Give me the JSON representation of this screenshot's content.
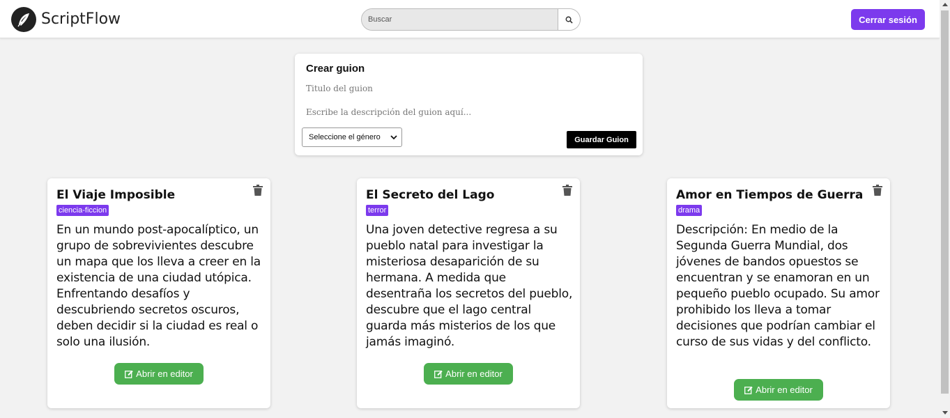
{
  "header": {
    "brand": "ScriptFlow",
    "logo_icon": "feather-icon",
    "search_placeholder": "Buscar",
    "search_icon": "search-icon",
    "logout_label": "Cerrar sesión"
  },
  "create": {
    "title": "Crear guion",
    "title_placeholder": "Titulo del guion",
    "desc_placeholder": "Escribe la descripción del guion aquí...",
    "genre_selected": "Seleccione el género",
    "save_label": "Guardar Guion"
  },
  "scripts": [
    {
      "title": "El Viaje Imposible",
      "genre": "ciencia-ficcion",
      "description": "En un mundo post-apocalíptico, un grupo de sobrevivientes descubre un mapa que los lleva a creer en la existencia de una ciudad utópica. Enfrentando desafíos y descubriendo secretos oscuros, deben decidir si la ciudad es real o solo una ilusión.",
      "open_label": "Abrir en editor"
    },
    {
      "title": "El Secreto del Lago",
      "genre": "terror",
      "description": "Una joven detective regresa a su pueblo natal para investigar la misteriosa desaparición de su hermana. A medida que desentraña los secretos del pueblo, descubre que el lago central guarda más misterios de los que jamás imaginó.",
      "open_label": "Abrir en editor"
    },
    {
      "title": "Amor en Tiempos de Guerra",
      "genre": "drama",
      "description": "Descripción: En medio de la Segunda Guerra Mundial, dos jóvenes de bandos opuestos se encuentran y se enamoran en un pequeño pueblo ocupado. Su amor prohibido los lleva a tomar decisiones que podrían cambiar el curso de sus vidas y del conflicto.",
      "open_label": "Abrir en editor"
    }
  ],
  "colors": {
    "accent": "#7c3aed",
    "open_button": "#4caf50",
    "save_button": "#000000"
  }
}
